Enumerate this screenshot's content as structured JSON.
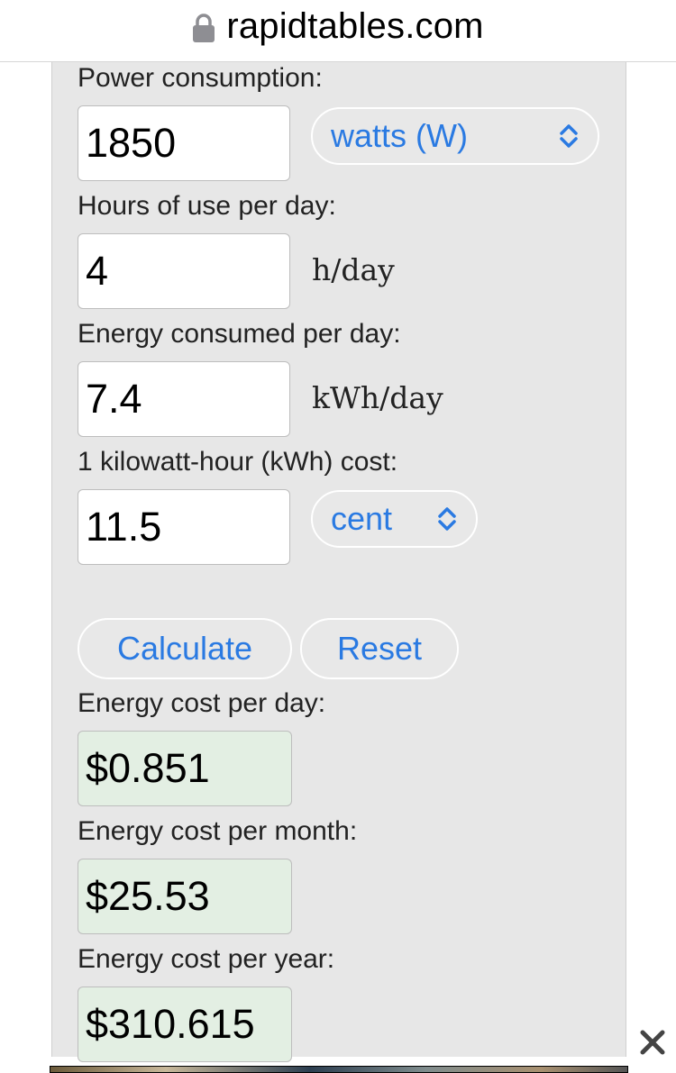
{
  "browser": {
    "domain": "rapidtables.com"
  },
  "form": {
    "power": {
      "label": "Power consumption:",
      "value": "1850",
      "unit_option": "watts (W)"
    },
    "hours": {
      "label": "Hours of use per day:",
      "value": "4",
      "unit": "h/day"
    },
    "energy": {
      "label": "Energy consumed per day:",
      "value": "7.4",
      "unit": "kWh/day"
    },
    "cost": {
      "label": "1 kilowatt-hour (kWh) cost:",
      "value": "11.5",
      "unit_option": "cent"
    },
    "calculate_label": "Calculate",
    "reset_label": "Reset"
  },
  "results": {
    "day": {
      "label": "Energy cost per day:",
      "value": "$0.851"
    },
    "month": {
      "label": "Energy cost per month:",
      "value": "$25.53"
    },
    "year": {
      "label": "Energy cost per year:",
      "value": "$310.615"
    }
  },
  "colors": {
    "accent": "#2a7ae2",
    "panel": "#e7e7e7",
    "result_bg": "#e3efe3"
  }
}
